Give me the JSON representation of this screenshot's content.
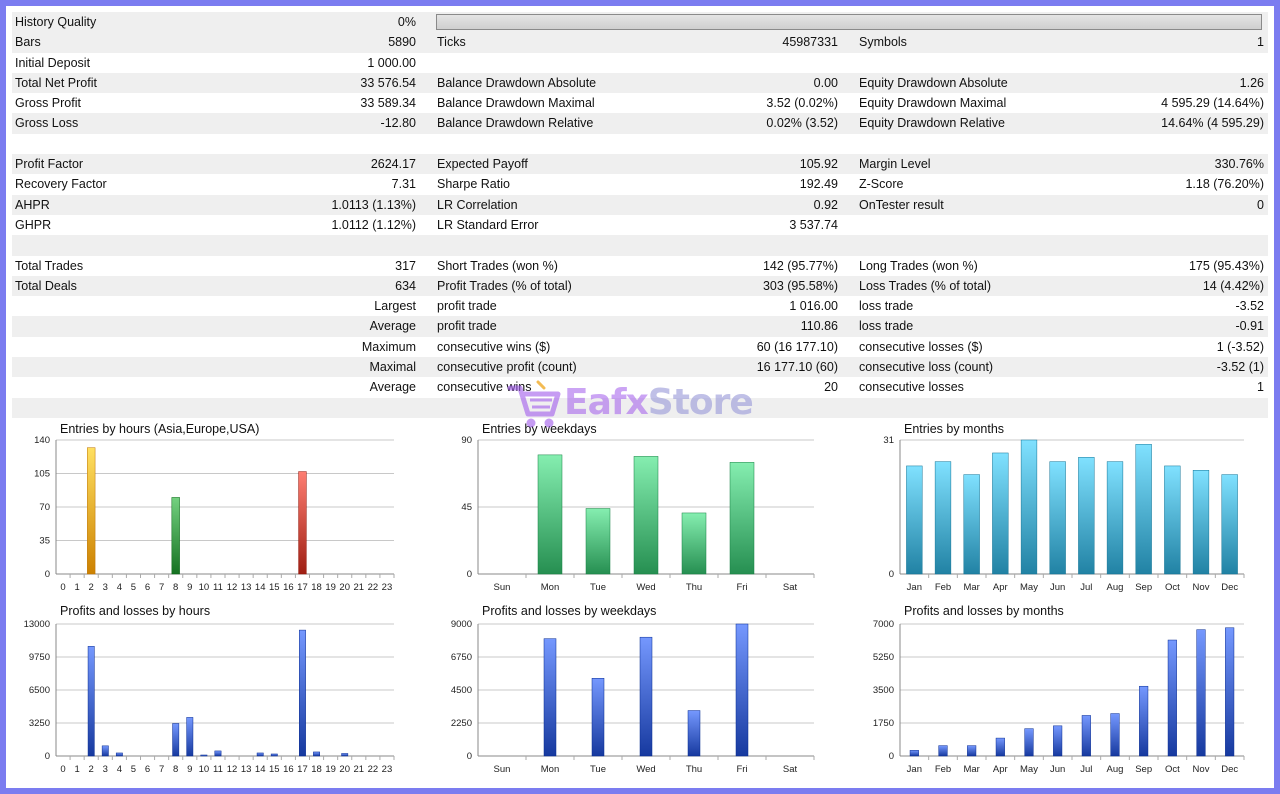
{
  "stats": [
    {
      "shade": true,
      "c1l": "History Quality",
      "c1v": "0%",
      "c2l": "",
      "c2v": "",
      "c3l": "",
      "c3v": "",
      "bar": true
    },
    {
      "shade": true,
      "c1l": "Bars",
      "c1v": "5890",
      "c2l": "Ticks",
      "c2v": "45987331",
      "c3l": "Symbols",
      "c3v": "1"
    },
    {
      "shade": false,
      "c1l": "Initial Deposit",
      "c1v": "1 000.00",
      "c2l": "",
      "c2v": "",
      "c3l": "",
      "c3v": ""
    },
    {
      "shade": true,
      "c1l": "Total Net Profit",
      "c1v": "33 576.54",
      "c2l": "Balance Drawdown Absolute",
      "c2v": "0.00",
      "c3l": "Equity Drawdown Absolute",
      "c3v": "1.26"
    },
    {
      "shade": false,
      "c1l": "Gross Profit",
      "c1v": "33 589.34",
      "c2l": "Balance Drawdown Maximal",
      "c2v": "3.52 (0.02%)",
      "c3l": "Equity Drawdown Maximal",
      "c3v": "4 595.29 (14.64%)"
    },
    {
      "shade": true,
      "c1l": "Gross Loss",
      "c1v": "-12.80",
      "c2l": "Balance Drawdown Relative",
      "c2v": "0.02% (3.52)",
      "c3l": "Equity Drawdown Relative",
      "c3v": "14.64% (4 595.29)"
    },
    {
      "shade": false,
      "c1l": "",
      "c1v": "",
      "c2l": "",
      "c2v": "",
      "c3l": "",
      "c3v": ""
    },
    {
      "shade": true,
      "c1l": "Profit Factor",
      "c1v": "2624.17",
      "c2l": "Expected Payoff",
      "c2v": "105.92",
      "c3l": "Margin Level",
      "c3v": "330.76%"
    },
    {
      "shade": false,
      "c1l": "Recovery Factor",
      "c1v": "7.31",
      "c2l": "Sharpe Ratio",
      "c2v": "192.49",
      "c3l": "Z-Score",
      "c3v": "1.18 (76.20%)"
    },
    {
      "shade": true,
      "c1l": "AHPR",
      "c1v": "1.0113 (1.13%)",
      "c2l": "LR Correlation",
      "c2v": "0.92",
      "c3l": "OnTester result",
      "c3v": "0"
    },
    {
      "shade": false,
      "c1l": "GHPR",
      "c1v": "1.0112 (1.12%)",
      "c2l": "LR Standard Error",
      "c2v": "3 537.74",
      "c3l": "",
      "c3v": ""
    },
    {
      "shade": true,
      "c1l": "",
      "c1v": "",
      "c2l": "",
      "c2v": "",
      "c3l": "",
      "c3v": ""
    },
    {
      "shade": false,
      "c1l": "Total Trades",
      "c1v": "317",
      "c2l": "Short Trades (won %)",
      "c2v": "142 (95.77%)",
      "c3l": "Long Trades (won %)",
      "c3v": "175 (95.43%)"
    },
    {
      "shade": true,
      "c1l": "Total Deals",
      "c1v": "634",
      "c2l": "Profit Trades (% of total)",
      "c2v": "303 (95.58%)",
      "c3l": "Loss Trades (% of total)",
      "c3v": "14 (4.42%)"
    },
    {
      "shade": false,
      "c1l": "",
      "c1v": "Largest",
      "c2l": "profit trade",
      "c2v": "1 016.00",
      "c3l": "loss trade",
      "c3v": "-3.52"
    },
    {
      "shade": true,
      "c1l": "",
      "c1v": "Average",
      "c2l": "profit trade",
      "c2v": "110.86",
      "c3l": "loss trade",
      "c3v": "-0.91"
    },
    {
      "shade": false,
      "c1l": "",
      "c1v": "Maximum",
      "c2l": "consecutive wins ($)",
      "c2v": "60 (16 177.10)",
      "c3l": "consecutive losses ($)",
      "c3v": "1 (-3.52)"
    },
    {
      "shade": true,
      "c1l": "",
      "c1v": "Maximal",
      "c2l": "consecutive profit (count)",
      "c2v": "16 177.10 (60)",
      "c3l": "consecutive loss (count)",
      "c3v": "-3.52 (1)"
    },
    {
      "shade": false,
      "c1l": "",
      "c1v": "Average",
      "c2l": "consecutive wins",
      "c2v": "20",
      "c3l": "consecutive losses",
      "c3v": "1"
    },
    {
      "shade": true,
      "c1l": "",
      "c1v": "",
      "c2l": "",
      "c2v": "",
      "c3l": "",
      "c3v": ""
    }
  ],
  "watermark": {
    "brand": "Eafx",
    "suffix": "Store"
  },
  "colors": {
    "hours_green": "#2e8b3a",
    "hours_orange": "#e59a1a",
    "hours_red": "#b8382c",
    "weekdays": "#3fa86a",
    "months": "#3a9bbd",
    "profits": "#2f52b8"
  },
  "chart_data": [
    {
      "type": "bar",
      "title": "Entries by hours (Asia,Europe,USA)",
      "categories": [
        "0",
        "1",
        "2",
        "3",
        "4",
        "5",
        "6",
        "7",
        "8",
        "9",
        "10",
        "11",
        "12",
        "13",
        "14",
        "15",
        "16",
        "17",
        "18",
        "19",
        "20",
        "21",
        "22",
        "23"
      ],
      "values": [
        0,
        0,
        132,
        0,
        0,
        0,
        0,
        0,
        80,
        0,
        0,
        0,
        0,
        0,
        0,
        0,
        0,
        107,
        0,
        0,
        0,
        0,
        0,
        0
      ],
      "bar_colors": {
        "2": "orange",
        "8": "green",
        "17": "red"
      },
      "yticks": [
        0,
        35,
        70,
        105,
        140
      ],
      "ylim": [
        0,
        140
      ]
    },
    {
      "type": "bar",
      "title": "Entries by weekdays",
      "categories": [
        "Sun",
        "Mon",
        "Tue",
        "Wed",
        "Thu",
        "Fri",
        "Sat"
      ],
      "values": [
        0,
        80,
        44,
        79,
        41,
        75,
        0
      ],
      "yticks": [
        0,
        45,
        90
      ],
      "ylim": [
        0,
        90
      ]
    },
    {
      "type": "bar",
      "title": "Entries by months",
      "categories": [
        "Jan",
        "Feb",
        "Mar",
        "Apr",
        "May",
        "Jun",
        "Jul",
        "Aug",
        "Sep",
        "Oct",
        "Nov",
        "Dec"
      ],
      "values": [
        25,
        26,
        23,
        28,
        31,
        26,
        27,
        26,
        30,
        25,
        24,
        23
      ],
      "yticks": [
        0,
        31
      ],
      "ylim": [
        0,
        31
      ]
    },
    {
      "type": "bar",
      "title": "Profits and losses by hours",
      "categories": [
        "0",
        "1",
        "2",
        "3",
        "4",
        "5",
        "6",
        "7",
        "8",
        "9",
        "10",
        "11",
        "12",
        "13",
        "14",
        "15",
        "16",
        "17",
        "18",
        "19",
        "20",
        "21",
        "22",
        "23"
      ],
      "values": [
        0,
        0,
        10800,
        1000,
        300,
        0,
        0,
        0,
        3200,
        3800,
        100,
        500,
        0,
        0,
        300,
        200,
        0,
        12400,
        400,
        0,
        250,
        0,
        0,
        0
      ],
      "yticks": [
        0,
        3250,
        6500,
        9750,
        13000
      ],
      "ylim": [
        0,
        13000
      ]
    },
    {
      "type": "bar",
      "title": "Profits and losses by weekdays",
      "categories": [
        "Sun",
        "Mon",
        "Tue",
        "Wed",
        "Thu",
        "Fri",
        "Sat"
      ],
      "values": [
        0,
        8000,
        5300,
        8100,
        3100,
        9000,
        0
      ],
      "yticks": [
        0,
        2250,
        4500,
        6750,
        9000
      ],
      "ylim": [
        0,
        9000
      ]
    },
    {
      "type": "bar",
      "title": "Profits and losses by months",
      "categories": [
        "Jan",
        "Feb",
        "Mar",
        "Apr",
        "May",
        "Jun",
        "Jul",
        "Aug",
        "Sep",
        "Oct",
        "Nov",
        "Dec"
      ],
      "values": [
        300,
        550,
        550,
        950,
        1450,
        1600,
        2150,
        2250,
        3700,
        6150,
        6700,
        6800
      ],
      "yticks": [
        0,
        1750,
        3500,
        5250,
        7000
      ],
      "ylim": [
        0,
        7000
      ]
    }
  ]
}
